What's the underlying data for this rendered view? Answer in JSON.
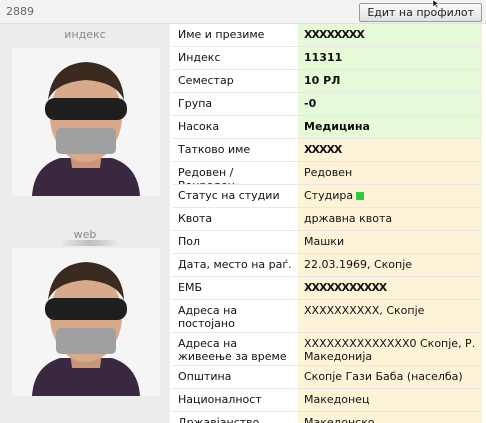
{
  "header": {
    "record_id": "2889",
    "edit_button": "Едит на профилот"
  },
  "photos": {
    "index_label": "индекс",
    "web_label": "web"
  },
  "rows": [
    {
      "label": "Име и презиме",
      "value": "XXXXXXXX"
    },
    {
      "label": "Индекс",
      "value": "11311"
    },
    {
      "label": "Семестар",
      "value": "10 РЛ"
    },
    {
      "label": "Група",
      "value": "-0"
    },
    {
      "label": "Насока",
      "value": "Медицина"
    },
    {
      "label": "Татково име",
      "value": "XXXXX"
    },
    {
      "label": "Редовен / Вонреден",
      "value": "Редовен"
    },
    {
      "label": "Статус на студии",
      "value": "Студира"
    },
    {
      "label": "Квота",
      "value": "државна квота"
    },
    {
      "label": "Пол",
      "value": "Машки"
    },
    {
      "label": "Дата, место на раѓ.",
      "value": "22.03.1969, Скопје"
    },
    {
      "label": "ЕМБ",
      "value": "XXXXXXXXXXX"
    },
    {
      "label": "Адреса на постојано живеење",
      "value": "XXXXXXXXXX, Скопје"
    },
    {
      "label": "Адреса на живеење за време на студии",
      "value": "XXXXXXXXXXXXXX0 Скопје, Р. Македонија"
    },
    {
      "label": "Општина",
      "value": "Скопје Гази Баба (населба)"
    },
    {
      "label": "Националност",
      "value": "Македонец"
    },
    {
      "label": "Државјанство",
      "value": "Македонско"
    }
  ],
  "colors": {
    "status_indicator": "#2ecc40",
    "highlight_green": "#e6fad8",
    "highlight_beige": "#fdf4d7"
  }
}
